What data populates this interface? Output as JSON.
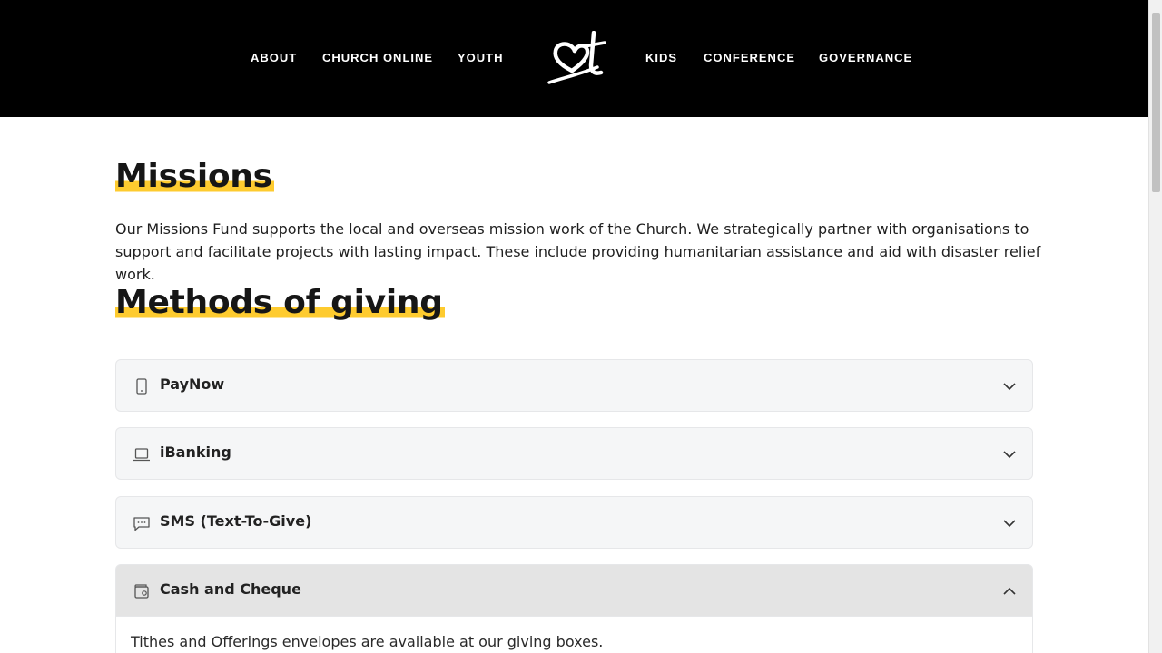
{
  "header": {
    "nav_left": [
      "ABOUT",
      "CHURCH ONLINE",
      "YOUTH"
    ],
    "nav_right": [
      "KIDS",
      "CONFERENCE",
      "GOVERNANCE"
    ],
    "logo_icon": "church-heart-logo-icon"
  },
  "main": {
    "title": "Missions",
    "intro": "Our Missions Fund supports the local and overseas mission work of the Church. We strategically partner with organisations to support and facilitate projects with lasting impact. These include providing humanitarian assistance and aid with disaster relief work.",
    "methods_title": "Methods of giving",
    "accordion": [
      {
        "title": "PayNow",
        "icon": "phone-icon",
        "expanded": false
      },
      {
        "title": "iBanking",
        "icon": "laptop-icon",
        "expanded": false
      },
      {
        "title": "SMS (Text-To-Give)",
        "icon": "chat-icon",
        "expanded": false
      },
      {
        "title": "Cash and Cheque",
        "icon": "wallet-icon",
        "expanded": true,
        "body": "Tithes and Offerings envelopes are available at our giving boxes."
      }
    ]
  },
  "colors": {
    "highlight": "#fecb2f",
    "header_bg": "#000000",
    "accordion_bg": "#f5f6f7",
    "accordion_open_bg": "#e4e4e4"
  }
}
